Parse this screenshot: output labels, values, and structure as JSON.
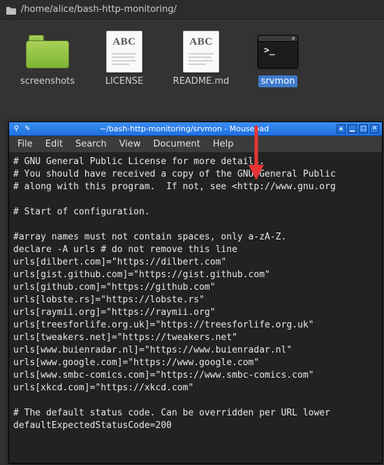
{
  "pathbar": {
    "path": "/home/alice/bash-http-monitoring/"
  },
  "files": [
    {
      "label": "screenshots",
      "kind": "folder",
      "selected": false
    },
    {
      "label": "LICENSE",
      "kind": "text",
      "selected": false
    },
    {
      "label": "README.md",
      "kind": "text",
      "selected": false
    },
    {
      "label": "srvmon",
      "kind": "script",
      "selected": true
    }
  ],
  "editor": {
    "title": "~/bash-http-monitoring/srvmon - Mousepad",
    "menus": [
      "File",
      "Edit",
      "Search",
      "View",
      "Document",
      "Help"
    ],
    "winbuttons": {
      "min": "▁",
      "max": "□",
      "close": "✕",
      "shade": "▴"
    },
    "content_lines": [
      "# GNU General Public License for more details.",
      "# You should have received a copy of the GNU General Public",
      "# along with this program.  If not, see <http://www.gnu.org",
      "",
      "# Start of configuration.",
      "",
      "#array names must not contain spaces, only a-zA-Z.",
      "declare -A urls # do not remove this line",
      "urls[dilbert.com]=\"https://dilbert.com\"",
      "urls[gist.github.com]=\"https://gist.github.com\"",
      "urls[github.com]=\"https://github.com\"",
      "urls[lobste.rs]=\"https://lobste.rs\"",
      "urls[raymii.org]=\"https://raymii.org\"",
      "urls[treesforlife.org.uk]=\"https://treesforlife.org.uk\"",
      "urls[tweakers.net]=\"https://tweakers.net\"",
      "urls[www.buienradar.nl]=\"https://www.buienradar.nl\"",
      "urls[www.google.com]=\"https://www.google.com\"",
      "urls[www.smbc-comics.com]=\"https://www.smbc-comics.com\"",
      "urls[xkcd.com]=\"https://xkcd.com\"",
      "",
      "# The default status code. Can be overridden per URL lower",
      "defaultExpectedStatusCode=200"
    ]
  }
}
